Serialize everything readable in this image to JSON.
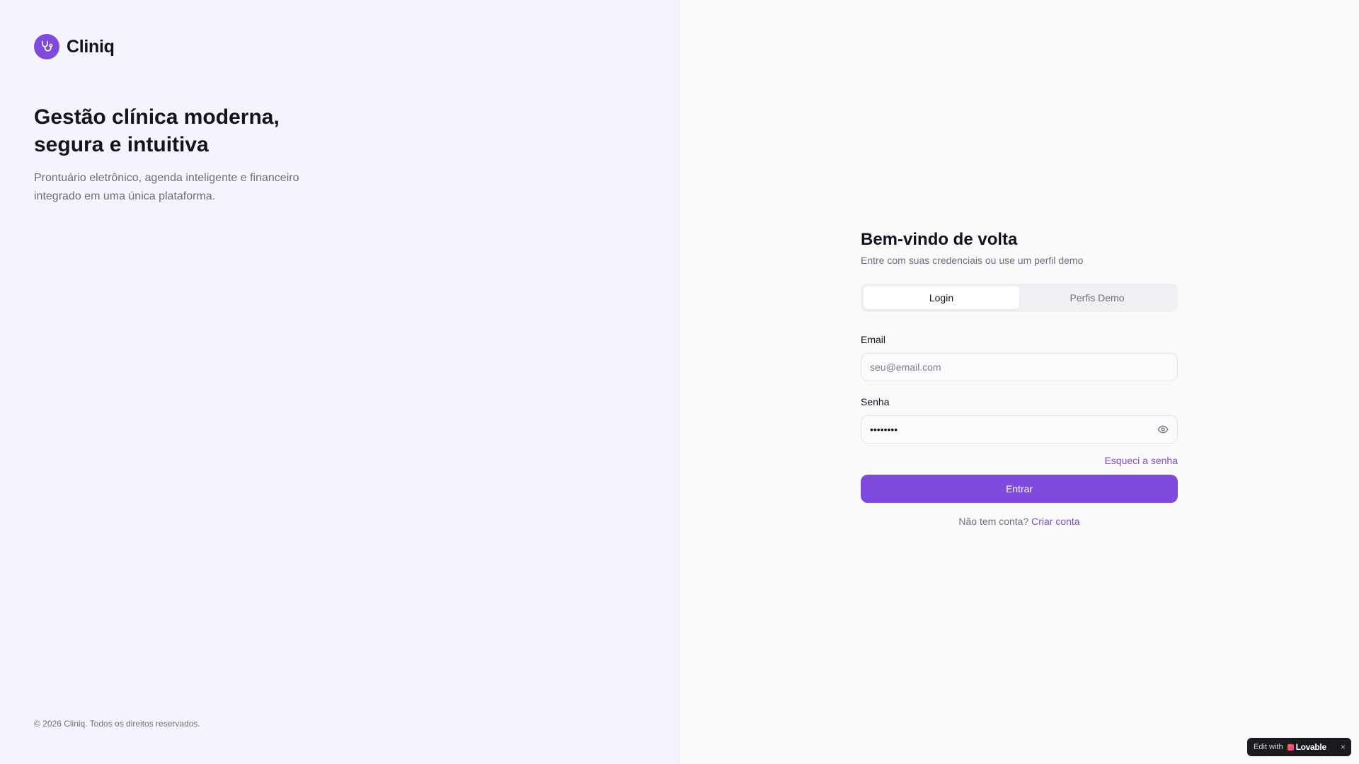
{
  "brand": {
    "name": "Cliniq",
    "icon": "stethoscope-icon",
    "color": "#7f49de"
  },
  "hero": {
    "title": "Gestão clínica moderna, segura e intuitiva",
    "subtitle": "Prontuário eletrônico, agenda inteligente e financeiro integrado em uma única plataforma."
  },
  "footer": {
    "copyright": "© 2026 Cliniq. Todos os direitos reservados."
  },
  "login": {
    "title": "Bem-vindo de volta",
    "subtitle": "Entre com suas credenciais ou use um perfil demo",
    "tabs": [
      {
        "label": "Login",
        "active": true
      },
      {
        "label": "Perfis Demo",
        "active": false
      }
    ],
    "email": {
      "label": "Email",
      "placeholder": "seu@email.com",
      "value": ""
    },
    "password": {
      "label": "Senha",
      "value": "••••••••",
      "toggle_icon": "eye-icon"
    },
    "forgot_label": "Esqueci a senha",
    "submit_label": "Entrar",
    "signup_prompt": "Não tem conta?",
    "signup_link": "Criar conta"
  },
  "lovable_badge": {
    "prefix": "Edit with",
    "brand": "Lovable",
    "close": "×"
  }
}
